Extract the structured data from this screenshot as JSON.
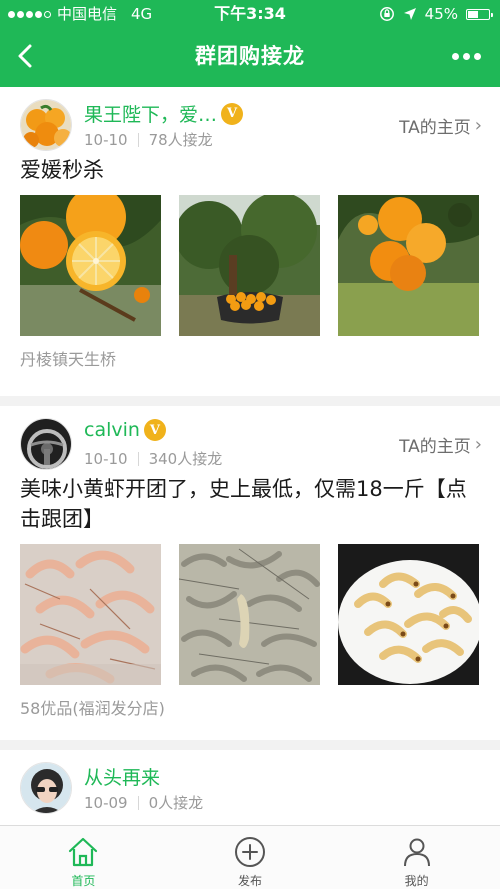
{
  "status_bar": {
    "carrier": "中国电信",
    "network": "4G",
    "time": "下午3:34",
    "battery": "45%",
    "battery_level": 0.45
  },
  "header": {
    "title": "群团购接龙",
    "back_icon": "chevron-left-icon",
    "more_icon": "more-dots-icon"
  },
  "posts": [
    {
      "author": "果王陛下，爱…",
      "verified_badge": "V",
      "date": "10-10",
      "joined": "78人接龙",
      "homepage_link": "TA的主页",
      "title": "爱媛秒杀",
      "photos": [
        "orange-cut-photo",
        "orange-orchard-photo",
        "oranges-on-tree-photo"
      ],
      "location": "丹棱镇天生桥"
    },
    {
      "author": "calvin",
      "verified_badge": "V",
      "date": "10-10",
      "joined": "340人接龙",
      "homepage_link": "TA的主页",
      "title": "美味小黄虾开团了，史上最低，仅需18一斤【点击跟团】",
      "photos": [
        "raw-shrimp-photo",
        "live-shrimp-photo",
        "cooked-shrimp-photo"
      ],
      "location": "58优品(福润发分店)"
    },
    {
      "author": "从头再来",
      "date": "10-09",
      "joined": "0人接龙"
    }
  ],
  "tabbar": {
    "home": "首页",
    "publish": "发布",
    "mine": "我的"
  },
  "colors": {
    "brand_green": "#1fb857",
    "badge_gold": "#f0b21b"
  }
}
